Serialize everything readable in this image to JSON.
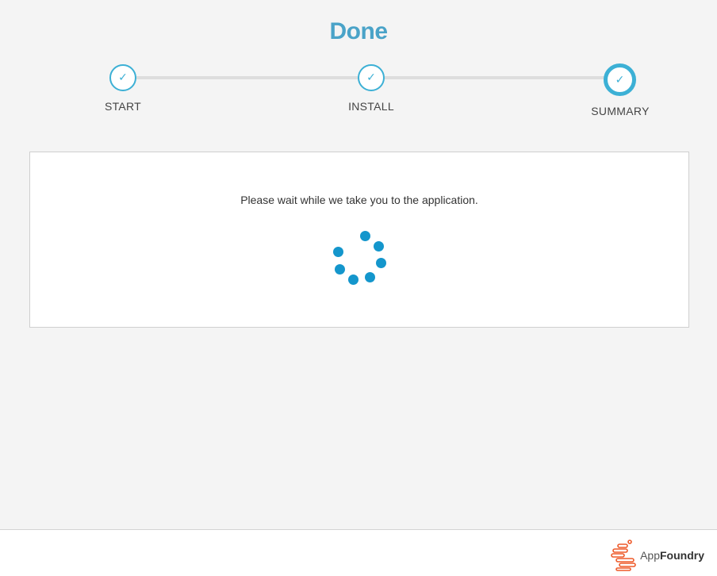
{
  "header": {
    "title": "Done"
  },
  "stepper": {
    "steps": [
      {
        "label": "START",
        "status": "complete"
      },
      {
        "label": "INSTALL",
        "status": "complete"
      },
      {
        "label": "SUMMARY",
        "status": "current"
      }
    ],
    "check_glyph": "✓",
    "accent_color": "#3cb0d5"
  },
  "main": {
    "message": "Please wait while we take you to the application.",
    "spinner_icon": "loading-spinner-icon",
    "spinner_color": "#1496cc"
  },
  "footer": {
    "brand_prefix": "App",
    "brand_suffix": "Foundry",
    "brand_icon": "appfoundry-logo-icon",
    "brand_color": "#ee5a2a"
  }
}
